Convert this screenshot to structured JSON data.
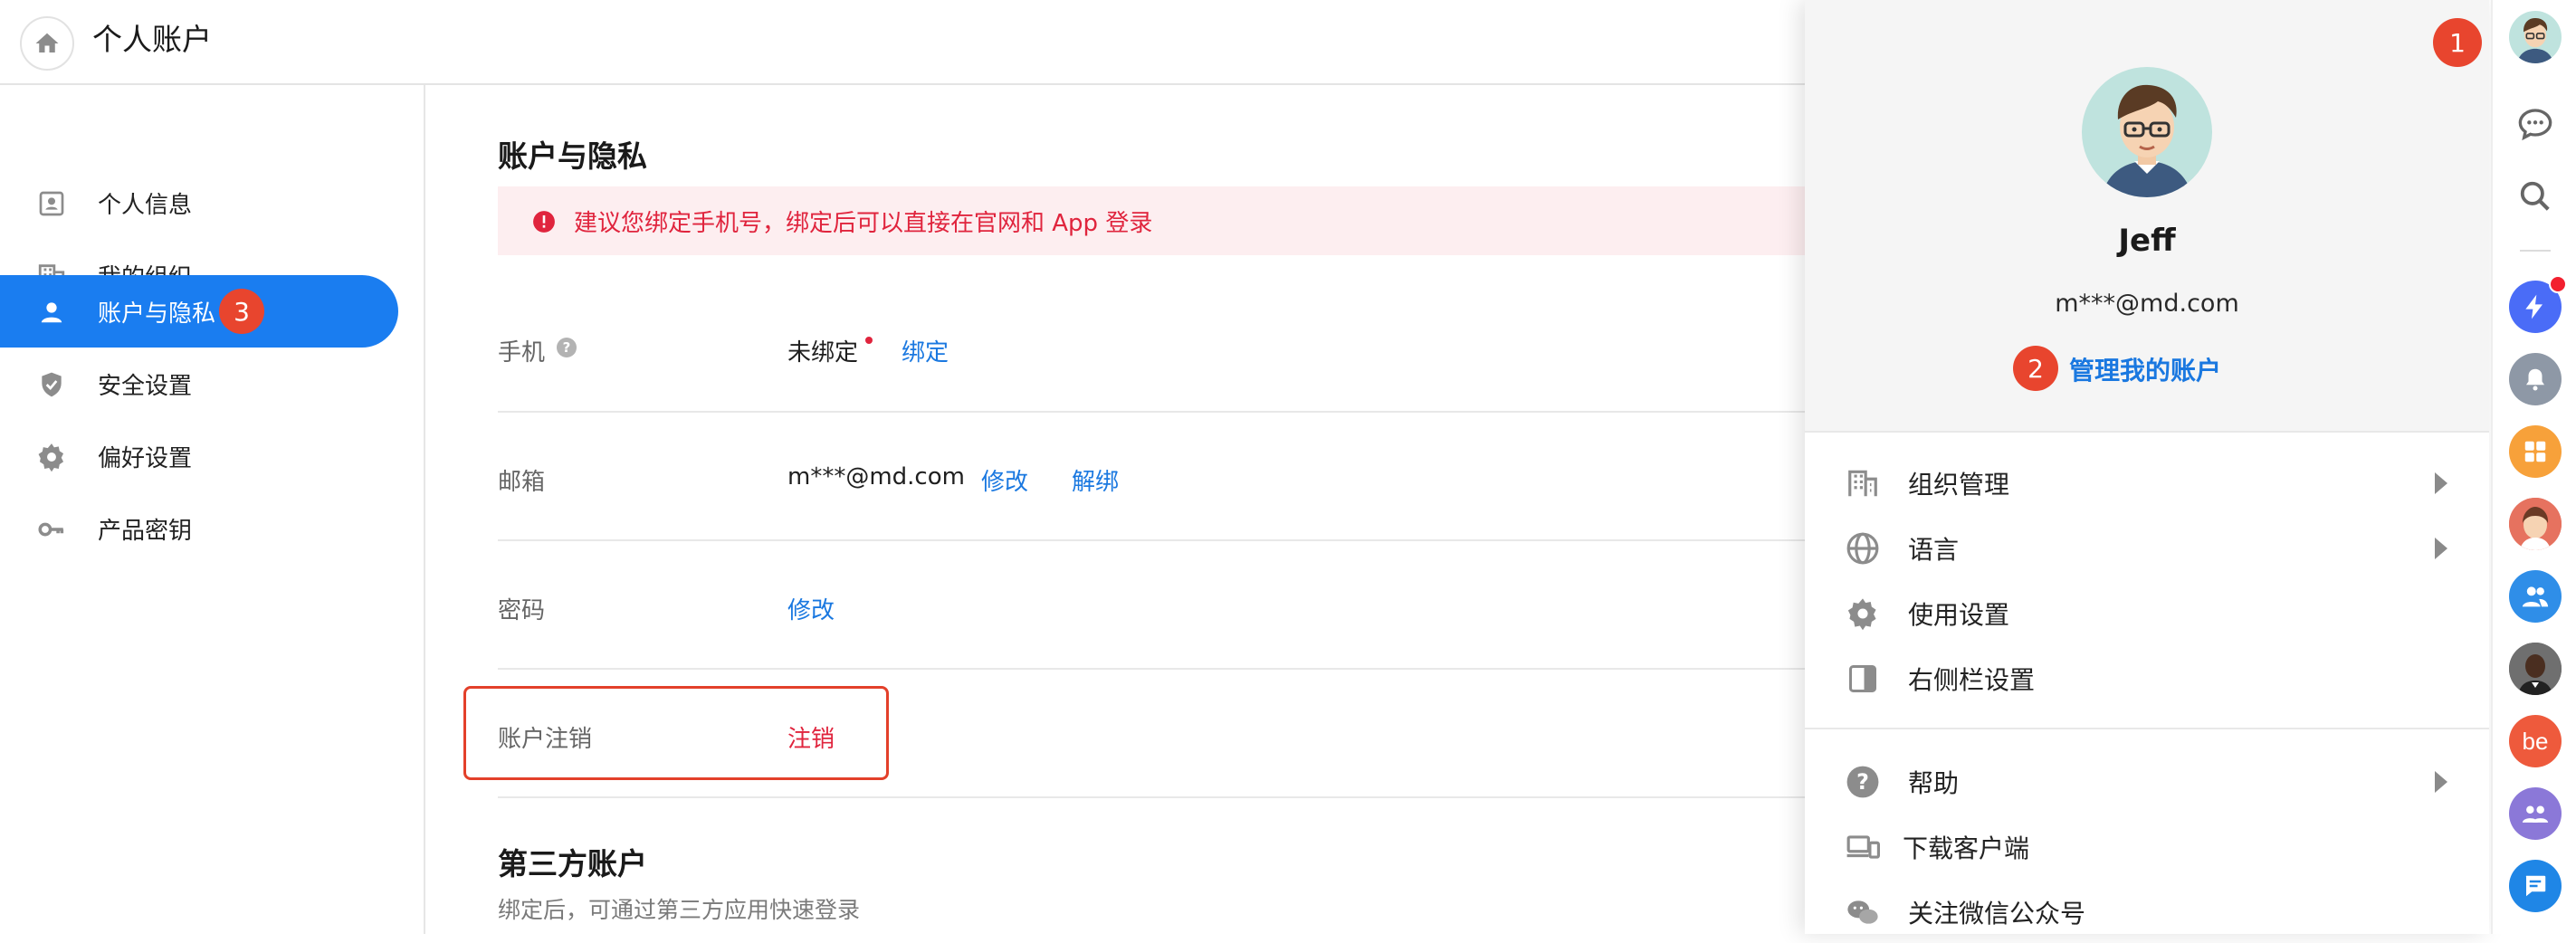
{
  "header": {
    "title": "个人账户",
    "home_icon": "home-icon"
  },
  "sidebar": {
    "items": [
      {
        "label": "个人信息",
        "icon": "id-card-icon"
      },
      {
        "label": "我的组织",
        "icon": "building-icon"
      },
      {
        "label": "账户与隐私",
        "icon": "user-icon",
        "active": true,
        "step": "3"
      },
      {
        "label": "安全设置",
        "icon": "shield-icon"
      },
      {
        "label": "偏好设置",
        "icon": "gear-icon"
      },
      {
        "label": "产品密钥",
        "icon": "key-icon"
      }
    ]
  },
  "main": {
    "title": "账户与隐私",
    "warning": "建议您绑定手机号，绑定后可以直接在官网和 App 登录",
    "rows": {
      "phone": {
        "label": "手机",
        "value": "未绑定",
        "action": "绑定"
      },
      "email": {
        "label": "邮箱",
        "value": "m***@md.com",
        "action1": "修改",
        "action2": "解绑"
      },
      "password": {
        "label": "密码",
        "action": "修改"
      },
      "delete": {
        "label": "账户注销",
        "action": "注销"
      }
    },
    "third_party": {
      "title": "第三方账户",
      "subtitle": "绑定后，可通过第三方应用快速登录"
    }
  },
  "panel": {
    "step1": "1",
    "name": "Jeff",
    "email": "m***@md.com",
    "step2": "2",
    "manage_link": "管理我的账户",
    "menu": [
      {
        "label": "组织管理",
        "icon": "building-icon",
        "submenu": true
      },
      {
        "label": "语言",
        "icon": "globe-icon",
        "submenu": true
      },
      {
        "label": "使用设置",
        "icon": "gear-icon",
        "submenu": false
      },
      {
        "label": "右侧栏设置",
        "icon": "sidebar-panel-icon",
        "submenu": false
      },
      {
        "label": "帮助",
        "icon": "help-icon",
        "submenu": true
      },
      {
        "label": "下载客户端",
        "icon": "devices-icon",
        "submenu": false
      },
      {
        "label": "关注微信公众号",
        "icon": "wechat-icon",
        "submenu": false
      }
    ]
  },
  "rail": {
    "be_label": "be"
  },
  "colors": {
    "accent": "#1a7df0",
    "danger": "#e0243d",
    "step_badge": "#e8452e"
  }
}
